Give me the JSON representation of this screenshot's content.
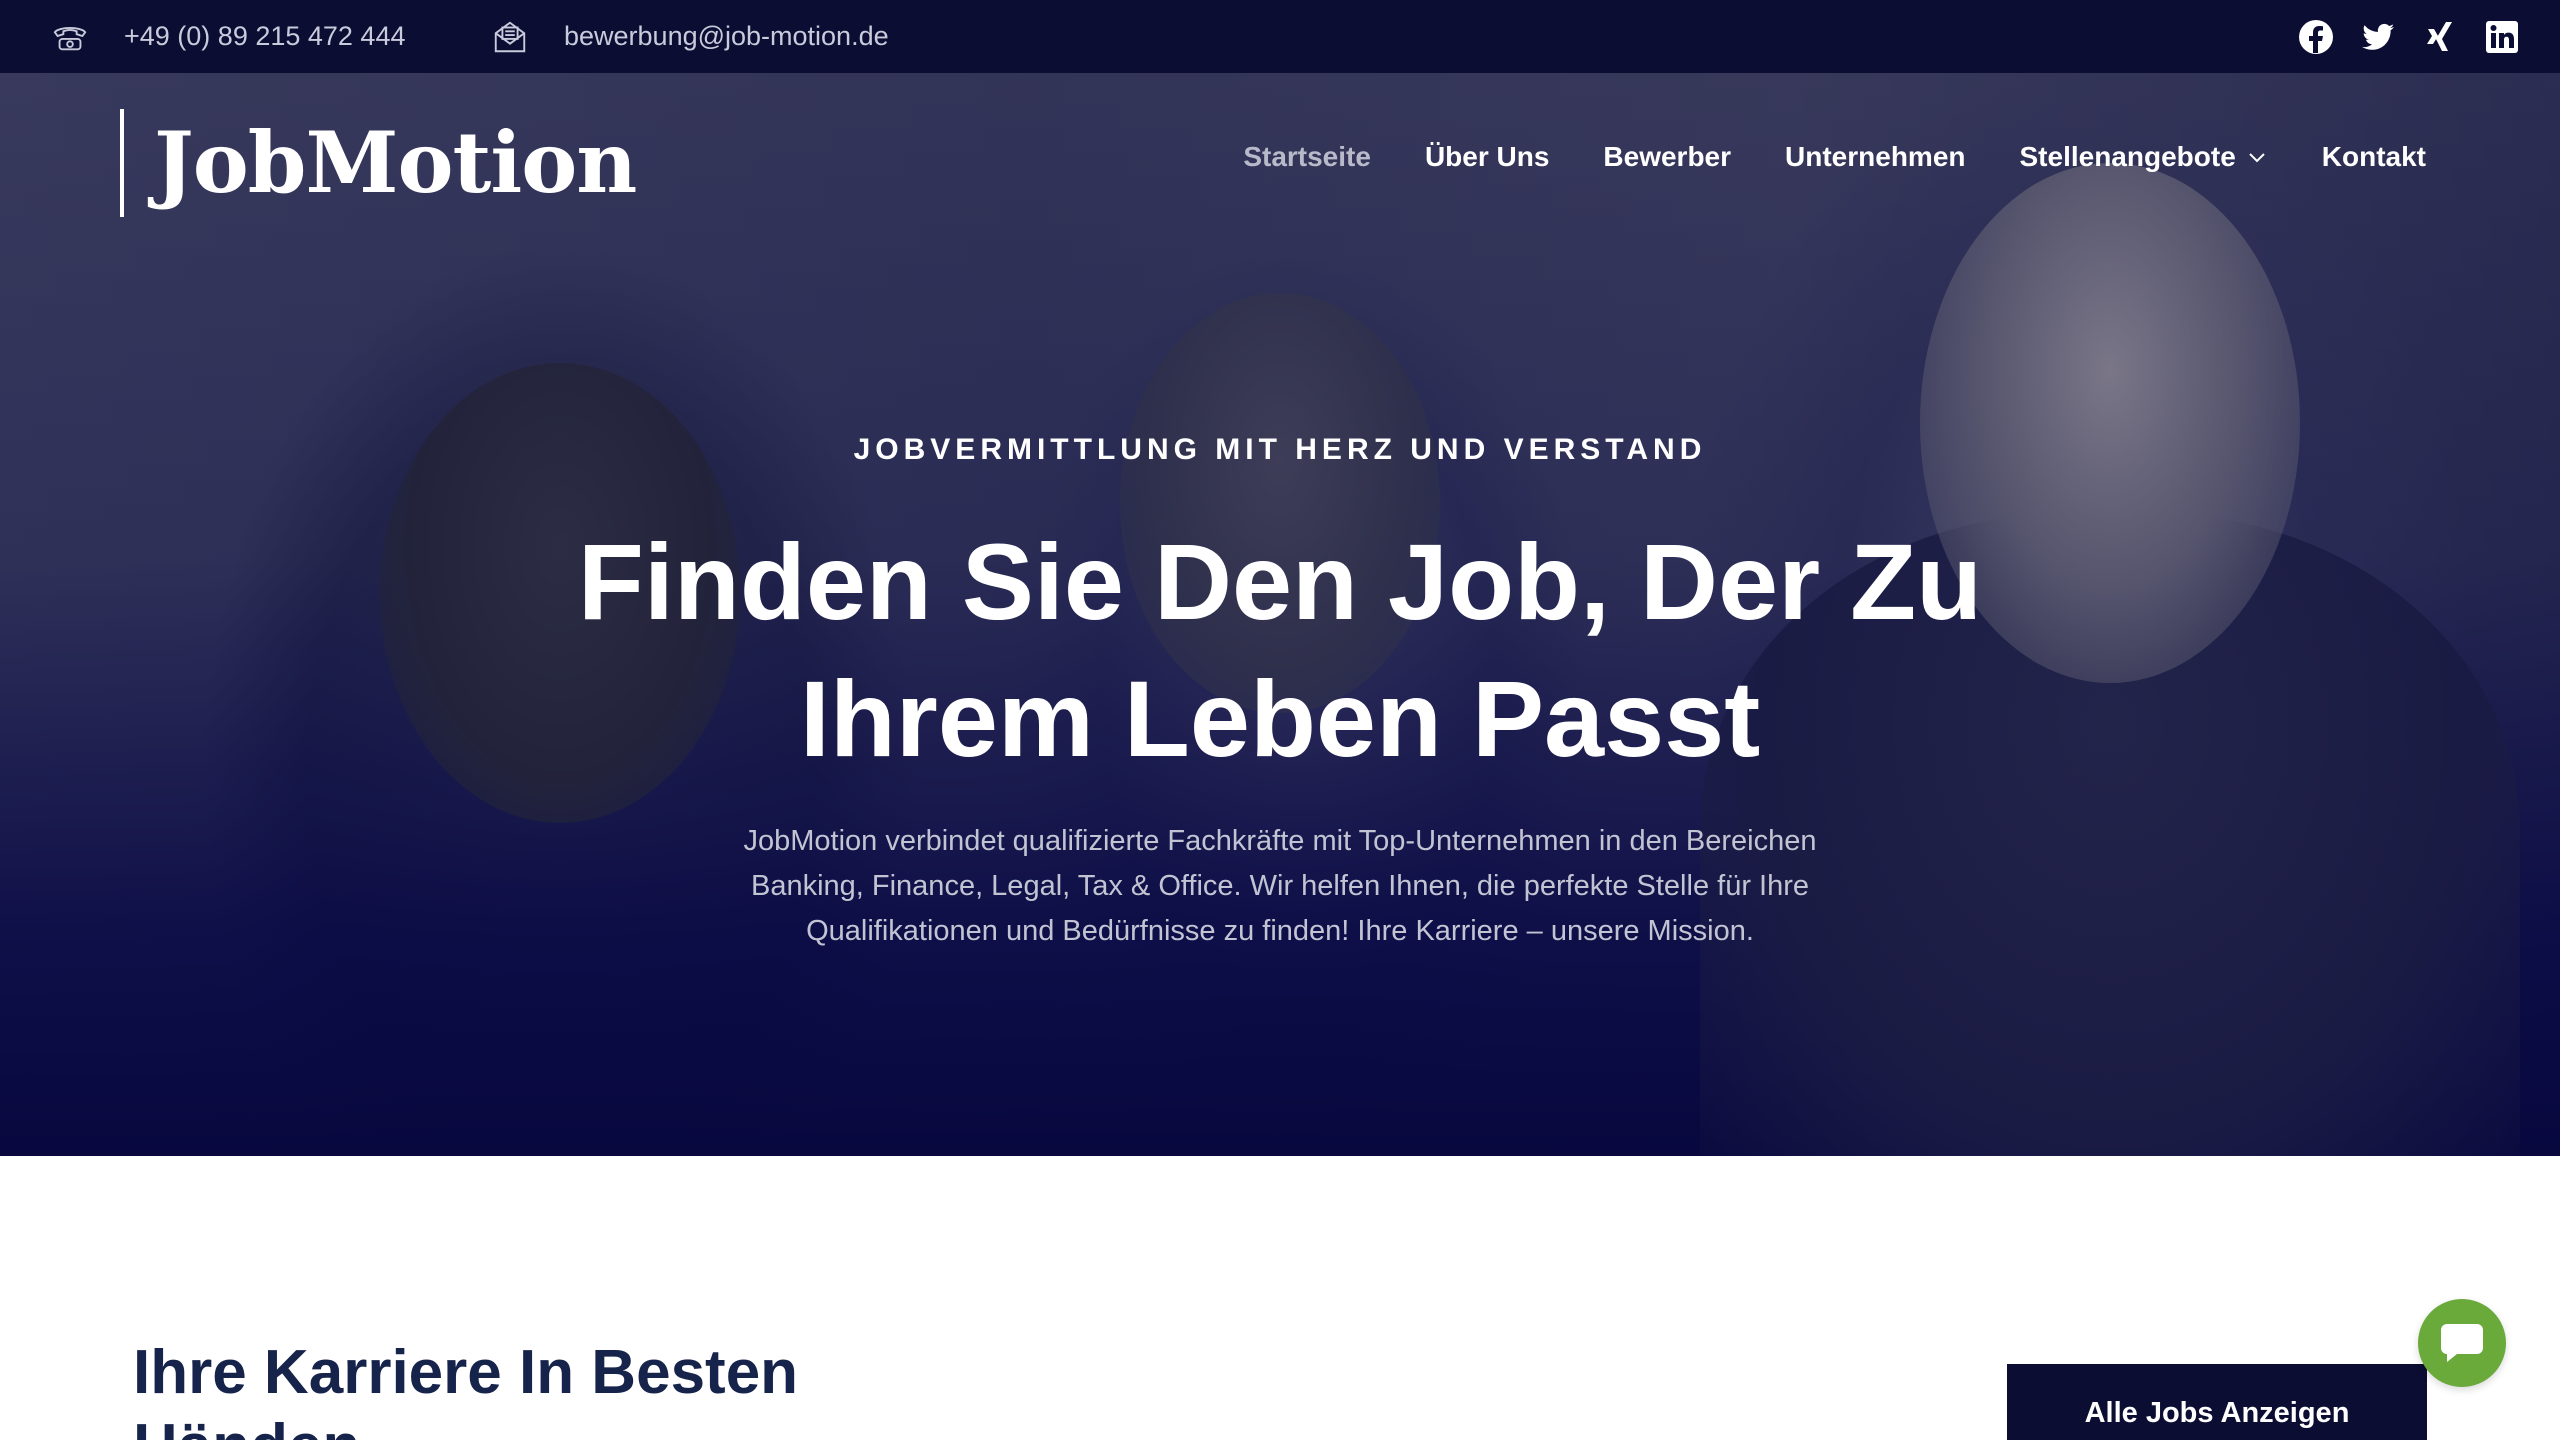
{
  "topbar": {
    "phone": "+49 (0) 89 215 472 444",
    "phone_icon": "phone-icon",
    "email": "bewerbung@job-motion.de",
    "email_icon": "mail-icon",
    "social_icons": [
      "facebook-icon",
      "twitter-icon",
      "xing-icon",
      "linkedin-icon"
    ]
  },
  "header": {
    "logo": "JobMotion",
    "nav": [
      {
        "label": "Startseite",
        "active": true
      },
      {
        "label": "Über Uns"
      },
      {
        "label": "Bewerber"
      },
      {
        "label": "Unternehmen"
      },
      {
        "label": "Stellenangebote",
        "has_dropdown": true
      },
      {
        "label": "Kontakt"
      }
    ]
  },
  "hero": {
    "eyebrow": "JOBVERMITTLUNG MIT HERZ UND VERSTAND",
    "headline_line1": "Finden Sie Den Job, Der Zu",
    "headline_line2": "Ihrem Leben Passt",
    "lead_line1": "JobMotion verbindet qualifizierte Fachkräfte mit Top-Unternehmen in den Bereichen",
    "lead_line2": "Banking, Finance, Legal, Tax & Office. Wir helfen Ihnen, die perfekte Stelle für Ihre",
    "lead_line3": "Qualifikationen und Bedürfnisse zu finden! Ihre Karriere – unsere Mission."
  },
  "main": {
    "section_title": "Ihre Karriere In Besten Händen",
    "all_jobs_label": "Alle Jobs Anzeigen"
  },
  "colors": {
    "topbar_bg": "#0b0d33",
    "hero_overlay": "#08083f",
    "heading_text": "#16234a",
    "chat_button": "#6aaa3a"
  }
}
